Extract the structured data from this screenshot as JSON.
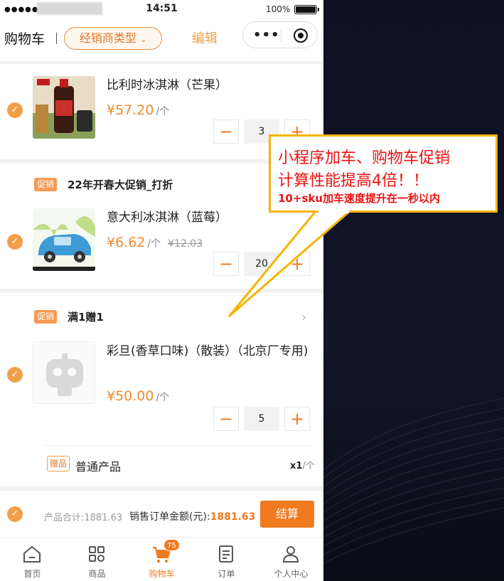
{
  "status": {
    "signal": "●●●●●",
    "time": "14:51",
    "battery": "100%"
  },
  "nav": {
    "title": "购物车",
    "type_filter": "经销商类型",
    "edit": "编辑"
  },
  "items": [
    {
      "name": "比利时冰淇淋（芒果）",
      "price": "¥57.20",
      "unit": "/个",
      "qty": "3"
    },
    {
      "name": "意大利冰淇淋（蓝莓）",
      "price": "¥6.62",
      "unit": "/个",
      "old_price": "¥12.03",
      "qty": "20"
    },
    {
      "name": "彩旦(香草口味)（散装）（北京厂专用)",
      "price": "¥50.00",
      "unit": "/个",
      "qty": "5"
    }
  ],
  "promos": [
    {
      "tag": "促销",
      "title": "22年开春大促销_打折"
    },
    {
      "tag": "促销",
      "title": "满1赠1"
    }
  ],
  "gift": {
    "tag": "赠品",
    "name": "普通产品",
    "qty": "x1",
    "unit": "/个"
  },
  "footer": {
    "total_label": "产品合计:1881.63",
    "order_label": "销售订单金额(元):",
    "order_amount": "1881.63",
    "checkout": "结算"
  },
  "tabs": [
    {
      "label": "首页",
      "icon": "home-icon"
    },
    {
      "label": "商品",
      "icon": "grid-icon"
    },
    {
      "label": "购物车",
      "icon": "cart-icon",
      "badge": "75"
    },
    {
      "label": "订单",
      "icon": "order-icon"
    },
    {
      "label": "个人中心",
      "icon": "user-icon"
    }
  ],
  "callout": {
    "line1": "小程序加车、购物车促销",
    "line2": "计算性能提高4倍！！",
    "line3": "10+sku加车速度提升在一秒以内"
  },
  "colors": {
    "accent": "#f07a20",
    "callout_border": "#f5b400",
    "callout_text": "#ee1111"
  }
}
